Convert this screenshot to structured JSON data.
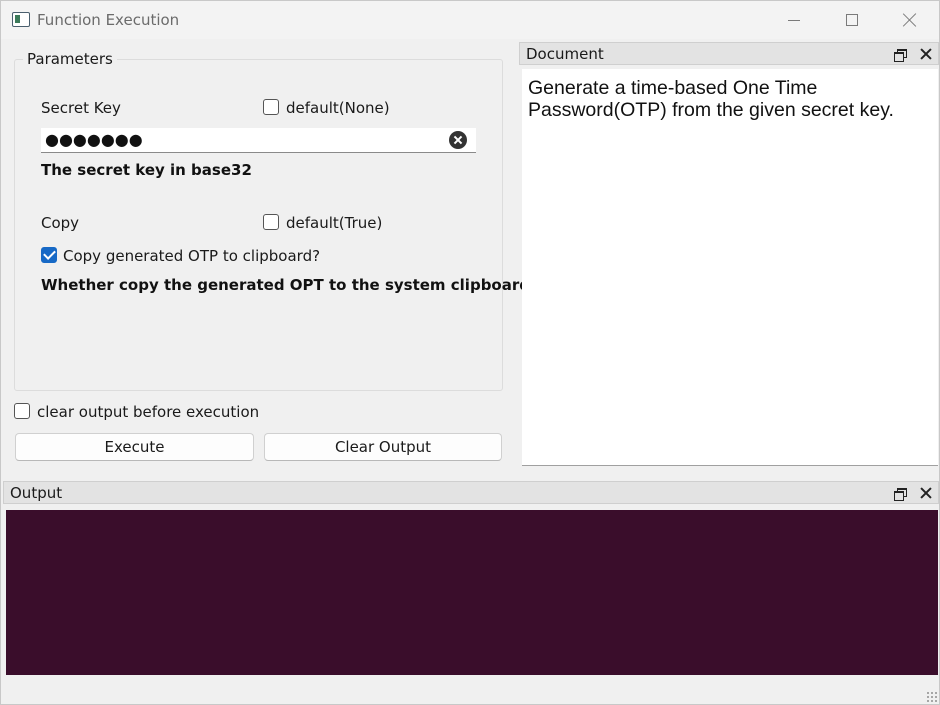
{
  "window": {
    "title": "Function Execution"
  },
  "parameters": {
    "group_title": "Parameters",
    "secret_key": {
      "label": "Secret Key",
      "default_checkbox_label": "default(None)",
      "default_checked": false,
      "masked_value": "●●●●●●●",
      "description": "The secret key in base32"
    },
    "copy": {
      "label": "Copy",
      "default_checkbox_label": "default(True)",
      "default_checked": false,
      "option_label": "Copy generated OTP to clipboard?",
      "option_checked": true,
      "description": "Whether copy the generated OPT to the system clipboard"
    }
  },
  "controls": {
    "clear_before_label": "clear output before execution",
    "clear_before_checked": false,
    "execute_label": "Execute",
    "clear_output_label": "Clear Output"
  },
  "document": {
    "title": "Document",
    "text": "Generate a time-based One Time Password(OTP) from the given secret key."
  },
  "output": {
    "title": "Output",
    "background_color": "#3a0d2b"
  },
  "colors": {
    "checkbox_accent": "#1769c6",
    "window_bg": "#f0f0f0"
  }
}
